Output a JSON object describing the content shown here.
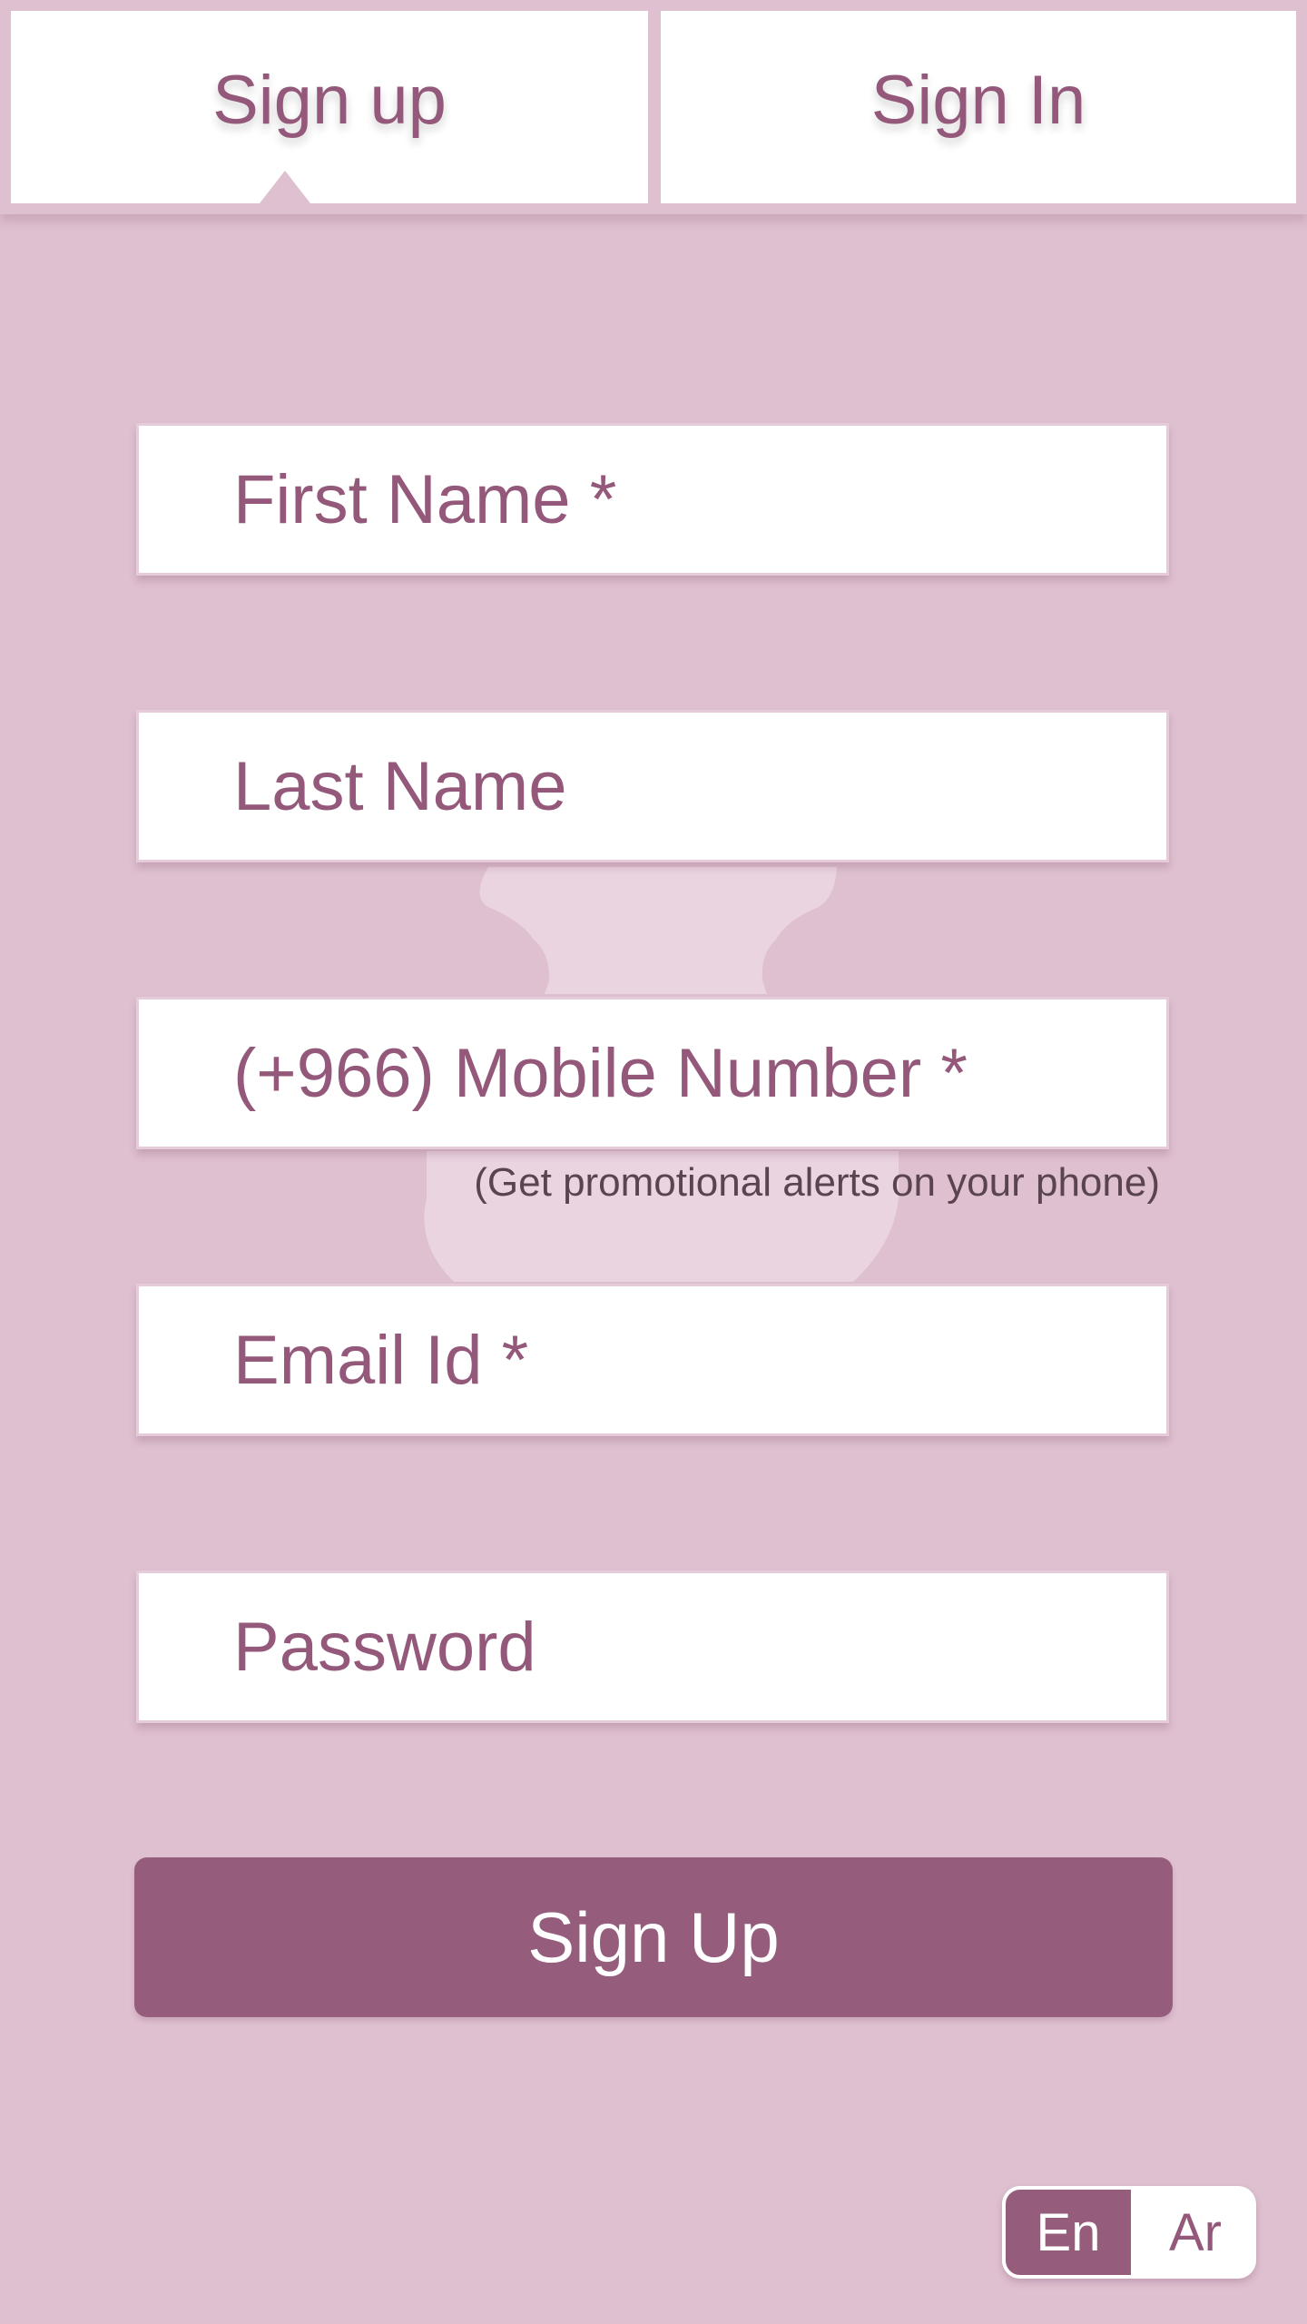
{
  "tabs": [
    {
      "label": "Sign up",
      "active": true
    },
    {
      "label": "Sign In",
      "active": false
    }
  ],
  "form": {
    "first_name_placeholder": "First Name *",
    "last_name_placeholder": "Last Name",
    "mobile_placeholder": "(+966) Mobile Number *",
    "mobile_hint": "(Get promotional alerts on your phone)",
    "email_placeholder": "Email Id *",
    "password_placeholder": "Password",
    "submit_label": "Sign Up"
  },
  "language": {
    "options": [
      "En",
      "Ar"
    ],
    "selected": "En"
  },
  "colors": {
    "background": "#dec0d0",
    "accent": "#955d7b",
    "text": "#94597a",
    "hint_text": "#5a4450"
  }
}
